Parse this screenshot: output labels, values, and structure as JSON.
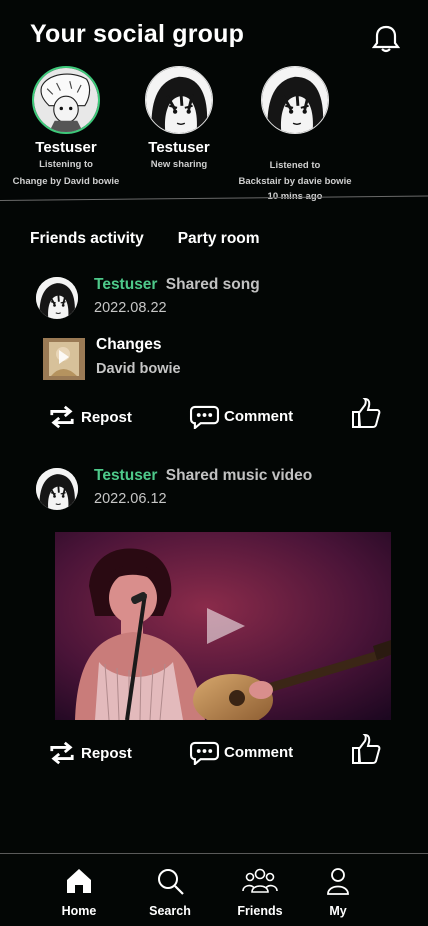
{
  "header": {
    "title": "Your social group",
    "notification_icon": "bell-icon"
  },
  "stories": [
    {
      "name": "Testuser",
      "status_line1": "Listening to",
      "status_line2": "Change by David bowie"
    },
    {
      "name": "Testuser",
      "status_line1": "New sharing"
    },
    {
      "name": "",
      "status_line1": "Listened to",
      "status_line2": "Backstair by davie bowie",
      "status_line3": "10 mins ago"
    }
  ],
  "tabs": [
    "Friends activity",
    "Party room"
  ],
  "posts": [
    {
      "user": "Testuser",
      "action": "Shared song",
      "date": "2022.08.22",
      "song": {
        "title": "Changes",
        "artist": "David bowie"
      },
      "buttons": {
        "repost": "Repost",
        "comment": "Comment"
      }
    },
    {
      "user": "Testuser",
      "action": "Shared music video",
      "date": "2022.06.12",
      "buttons": {
        "repost": "Repost",
        "comment": "Comment"
      }
    }
  ],
  "nav": [
    {
      "label": "Home",
      "icon": "home-icon"
    },
    {
      "label": "Search",
      "icon": "search-icon"
    },
    {
      "label": "Friends",
      "icon": "friends-icon"
    },
    {
      "label": "My",
      "icon": "profile-icon"
    }
  ],
  "colors": {
    "accent": "#4ec98a",
    "background": "#030605",
    "ring": "#3ec97a"
  }
}
